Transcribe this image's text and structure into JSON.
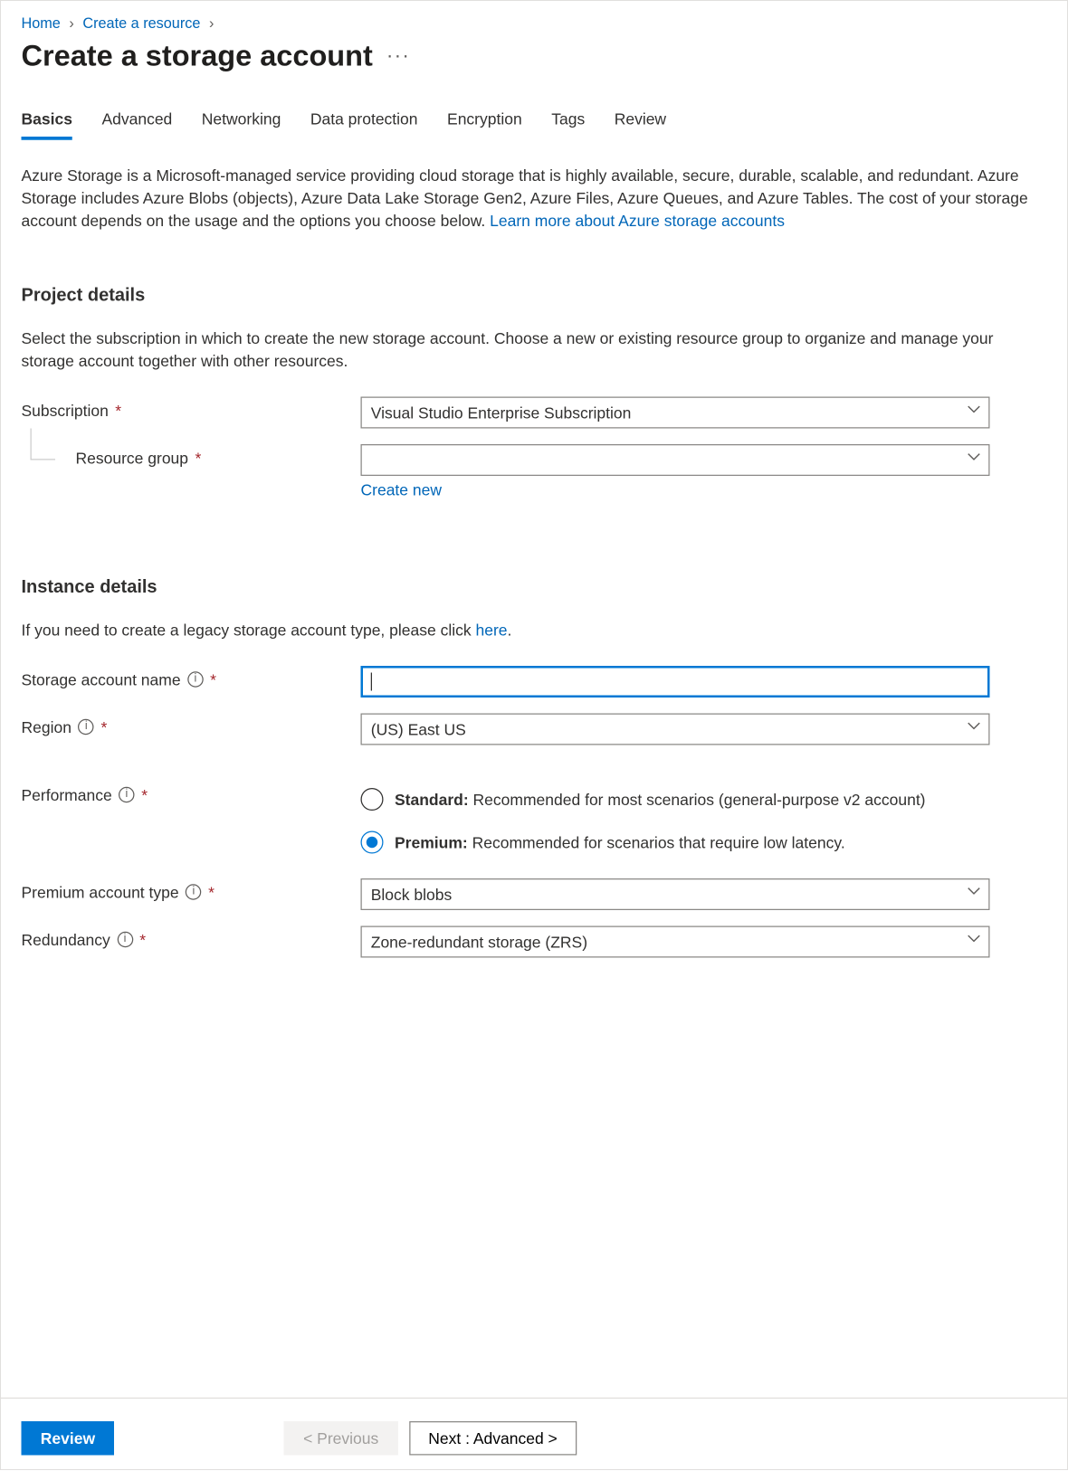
{
  "breadcrumb": {
    "home": "Home",
    "create_resource": "Create a resource"
  },
  "page_title": "Create a storage account",
  "tabs": {
    "basics": "Basics",
    "advanced": "Advanced",
    "networking": "Networking",
    "data_protection": "Data protection",
    "encryption": "Encryption",
    "tags": "Tags",
    "review": "Review"
  },
  "intro_text": "Azure Storage is a Microsoft-managed service providing cloud storage that is highly available, secure, durable, scalable, and redundant. Azure Storage includes Azure Blobs (objects), Azure Data Lake Storage Gen2, Azure Files, Azure Queues, and Azure Tables. The cost of your storage account depends on the usage and the options you choose below. ",
  "intro_link": "Learn more about Azure storage accounts",
  "project": {
    "heading": "Project details",
    "desc": "Select the subscription in which to create the new storage account. Choose a new or existing resource group to organize and manage your storage account together with other resources.",
    "subscription_label": "Subscription",
    "subscription_value": "Visual Studio Enterprise Subscription",
    "resource_group_label": "Resource group",
    "resource_group_value": "",
    "create_new": "Create new"
  },
  "instance": {
    "heading": "Instance details",
    "desc_prefix": "If you need to create a legacy storage account type, please click ",
    "desc_link": "here",
    "desc_suffix": ".",
    "name_label": "Storage account name",
    "name_value": "",
    "region_label": "Region",
    "region_value": "(US) East US",
    "performance_label": "Performance",
    "perf_standard_bold": "Standard:",
    "perf_standard_rest": " Recommended for most scenarios (general-purpose v2 account)",
    "perf_premium_bold": "Premium:",
    "perf_premium_rest": " Recommended for scenarios that require low latency.",
    "premium_type_label": "Premium account type",
    "premium_type_value": "Block blobs",
    "redundancy_label": "Redundancy",
    "redundancy_value": "Zone-redundant storage (ZRS)"
  },
  "footer": {
    "review": "Review",
    "previous": "< Previous",
    "next": "Next : Advanced >"
  }
}
